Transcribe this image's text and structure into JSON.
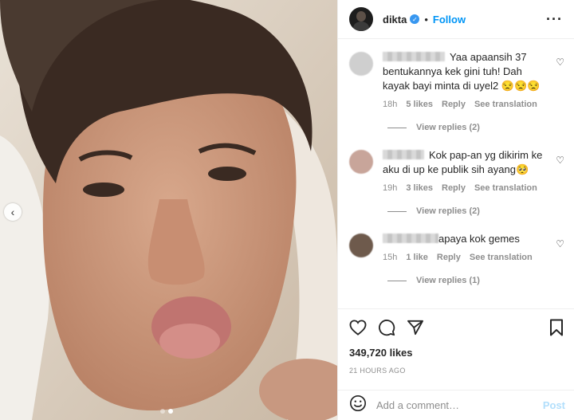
{
  "post": {
    "username": "dikta",
    "separator": "•",
    "follow_label": "Follow",
    "more_icon": "more-horizontal-icon",
    "nav_prev_icon": "chevron-left-icon",
    "carousel_dots": 2,
    "carousel_active": 1
  },
  "comments": [
    {
      "text": "Yaa apaansih 37 bentukannya kek gini tuh! Dah kayak bayi minta di uyel2 😒😒😒",
      "time": "18h",
      "likes": "5 likes",
      "reply": "Reply",
      "translate": "See translation",
      "view_replies": "View replies (2)",
      "avatar_color": "#c9c9c9"
    },
    {
      "text": "Kok pap-an yg dikirim ke aku di up ke publik sih ayang🥺",
      "time": "19h",
      "likes": "3 likes",
      "reply": "Reply",
      "translate": "See translation",
      "view_replies": "View replies (2)",
      "avatar_color": "#c8a59a"
    },
    {
      "text": "apaya kok gemes",
      "time": "15h",
      "likes": "1 like",
      "reply": "Reply",
      "translate": "See translation",
      "view_replies": "View replies (1)",
      "avatar_color": "#6e5a4c"
    }
  ],
  "actions": {
    "like_icon": "heart-icon",
    "comment_icon": "comment-icon",
    "share_icon": "send-icon",
    "save_icon": "bookmark-icon",
    "likes_count": "349,720 likes",
    "timestamp": "21 HOURS AGO"
  },
  "composer": {
    "emoji_icon": "emoji-icon",
    "placeholder": "Add a comment…",
    "post_label": "Post"
  },
  "colors": {
    "accent": "#0095f6",
    "verified": "#3897f0",
    "muted": "#8e8e8e",
    "post_disabled": "#b2dffc"
  }
}
